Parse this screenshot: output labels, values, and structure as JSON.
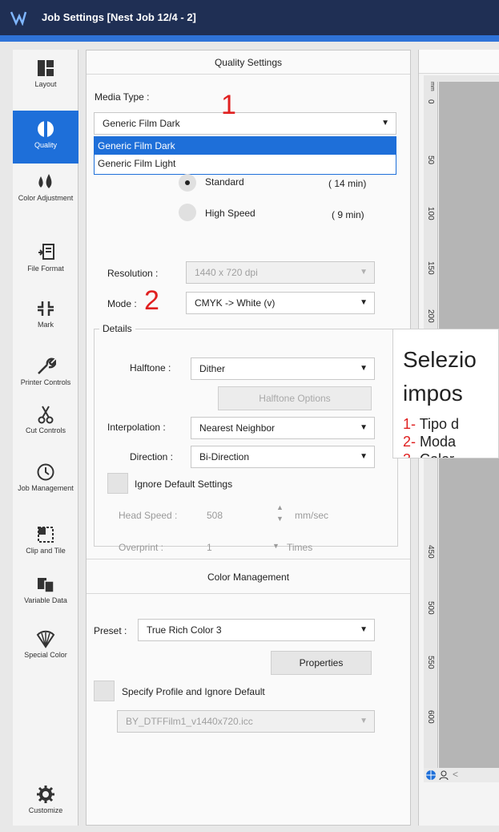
{
  "window": {
    "title": "Job Settings [Nest Job 12/4 - 2]"
  },
  "sidebar": {
    "items": [
      {
        "label": "Layout"
      },
      {
        "label": "Quality"
      },
      {
        "label": "Color Adjustment"
      },
      {
        "label": "File Format"
      },
      {
        "label": "Mark"
      },
      {
        "label": "Printer Controls"
      },
      {
        "label": "Cut Controls"
      },
      {
        "label": "Job Management"
      },
      {
        "label": "Clip and Tile"
      },
      {
        "label": "Variable Data"
      },
      {
        "label": "Special Color"
      },
      {
        "label": "Customize"
      }
    ]
  },
  "quality": {
    "header": "Quality Settings",
    "media_type_label": "Media Type :",
    "media_type_value": "Generic Film Dark",
    "media_options": [
      "Generic Film Dark",
      "Generic Film Light"
    ],
    "speed_standard": "Standard",
    "speed_standard_time": "( 14 min)",
    "speed_high": "High Speed",
    "speed_high_time": "( 9 min)",
    "resolution_label": "Resolution :",
    "resolution_value": "1440 x 720 dpi",
    "mode_label": "Mode :",
    "mode_value": "CMYK -> White (v)",
    "details_label": "Details",
    "halftone_label": "Halftone :",
    "halftone_value": "Dither",
    "halftone_options_button": "Halftone Options",
    "interpolation_label": "Interpolation :",
    "interpolation_value": "Nearest Neighbor",
    "direction_label": "Direction :",
    "direction_value": "Bi-Direction",
    "ignore_default_label": "Ignore Default Settings",
    "head_speed_label": "Head Speed :",
    "head_speed_value": "508",
    "head_speed_unit": "mm/sec",
    "overprint_label": "Overprint :",
    "overprint_value": "1",
    "overprint_unit": "Times"
  },
  "color_management": {
    "header": "Color Management",
    "preset_label": "Preset :",
    "preset_value": "True Rich Color 3",
    "properties_button": "Properties",
    "specify_profile_label": "Specify Profile and Ignore Default",
    "profile_value": "BY_DTFFilm1_v1440x720.icc"
  },
  "ruler": {
    "ticks": [
      "mm",
      "0",
      "50",
      "100",
      "150",
      "200",
      "450",
      "500",
      "550",
      "600"
    ]
  },
  "annotations": {
    "num1": "1",
    "num2": "2",
    "callout_line1": "Selezio",
    "callout_line2": "impos",
    "item1_num": "1-",
    "item1_text": " Tipo d",
    "item2_num": "2-",
    "item2_text": " Moda",
    "item3_num": "3-",
    "item3_text": " Color"
  },
  "colors": {
    "titlebar": "#1f2f54",
    "accent": "#1e6fd9",
    "annotation_red": "#e02020"
  }
}
